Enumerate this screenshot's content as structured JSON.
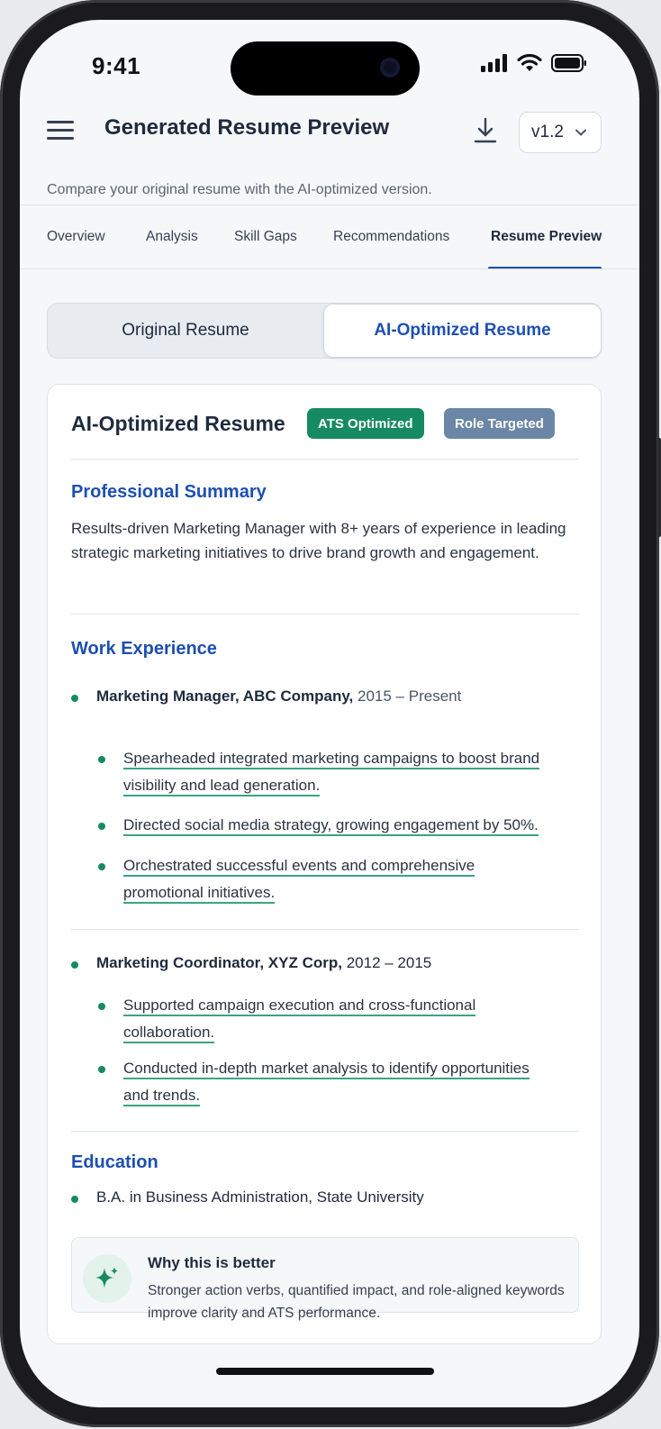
{
  "status_bar": {
    "time": "9:41"
  },
  "header": {
    "title": "Generated Resume Preview",
    "version": "v1.2",
    "subtitle": "Compare your original resume with the AI-optimized version."
  },
  "tabs": [
    {
      "label": "Overview",
      "active": false
    },
    {
      "label": "Analysis",
      "active": false
    },
    {
      "label": "Skill Gaps",
      "active": false
    },
    {
      "label": "Recommendations",
      "active": false
    },
    {
      "label": "Resume Preview",
      "active": true
    }
  ],
  "toggle": {
    "original": "Original Resume",
    "optimized": "AI-Optimized Resume",
    "selected": "optimized"
  },
  "card": {
    "title": "AI-Optimized Resume",
    "badges": [
      "ATS Optimized",
      "Role Targeted"
    ],
    "summary": {
      "heading": "Professional Summary",
      "text": "Results-driven Marketing Manager with 8+ years of experience in leading strategic marketing initiatives to drive brand growth and engagement."
    },
    "experience": {
      "heading": "Work Experience",
      "jobs": [
        {
          "title": "Marketing Manager, ABC Company,",
          "dates": "2015 – Present",
          "bullets": [
            {
              "line1": "Spearheaded integrated marketing campaigns to boost brand",
              "line2": "visibility and lead generation."
            },
            {
              "line1": "Directed social media strategy, growing engagement by 50%.",
              "line2": ""
            },
            {
              "line1": "Orchestrated successful events and comprehensive",
              "line2": "promotional initiatives."
            }
          ]
        },
        {
          "title": "Marketing Coordinator, XYZ Corp,",
          "dates": "2012 – 2015",
          "bullets": [
            {
              "line1": "Supported campaign execution and cross-functional",
              "line2": "collaboration."
            },
            {
              "line1": "Conducted in-depth market analysis to identify opportunities",
              "line2": "and trends."
            }
          ]
        }
      ]
    },
    "education": {
      "heading": "Education",
      "items": [
        "B.A. in Business Administration, State University"
      ]
    },
    "why": {
      "title": "Why this is better",
      "text": "Stronger action verbs, quantified impact, and role-aligned keywords improve clarity and ATS performance."
    }
  },
  "colors": {
    "accent": "#1e4fb0",
    "success": "#168a63",
    "muted_badge": "#6b86a6"
  },
  "icons": [
    "menu-icon",
    "download-icon",
    "chevron-down-icon",
    "signal-icon",
    "wifi-icon",
    "battery-icon",
    "sparkle-icon"
  ]
}
